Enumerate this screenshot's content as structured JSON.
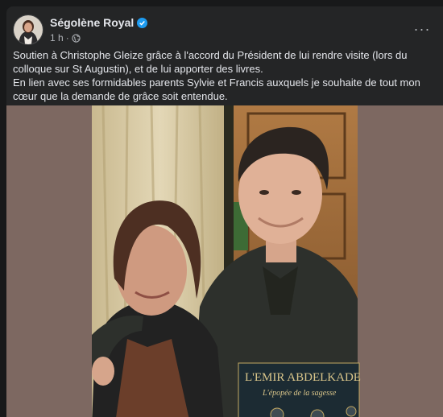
{
  "post": {
    "author": "Ségolène Royal",
    "time": "1 h",
    "separator": "·",
    "audience_icon": "globe-icon",
    "more_label": "···",
    "text_line1": "Soutien à Christophe Gleize grâce à l'accord du Président de lui rendre visite (lors du colloque sur St Augustin), et de lui apporter des livres.",
    "text_line2": "En lien avec ses formidables parents Sylvie et Francis auxquels je souhaite de tout mon cœur que la demande de grâce soit entendue."
  },
  "photo": {
    "book_title": "L'EMIR ABDELKADE",
    "book_subtitle": "L'épopée de la sagesse"
  },
  "colors": {
    "background": "#18191a",
    "card": "#242526",
    "text_primary": "#e4e6eb",
    "text_secondary": "#b0b3b8",
    "verified_blue": "#1d9bf0",
    "photo_border": "#7d6861"
  }
}
